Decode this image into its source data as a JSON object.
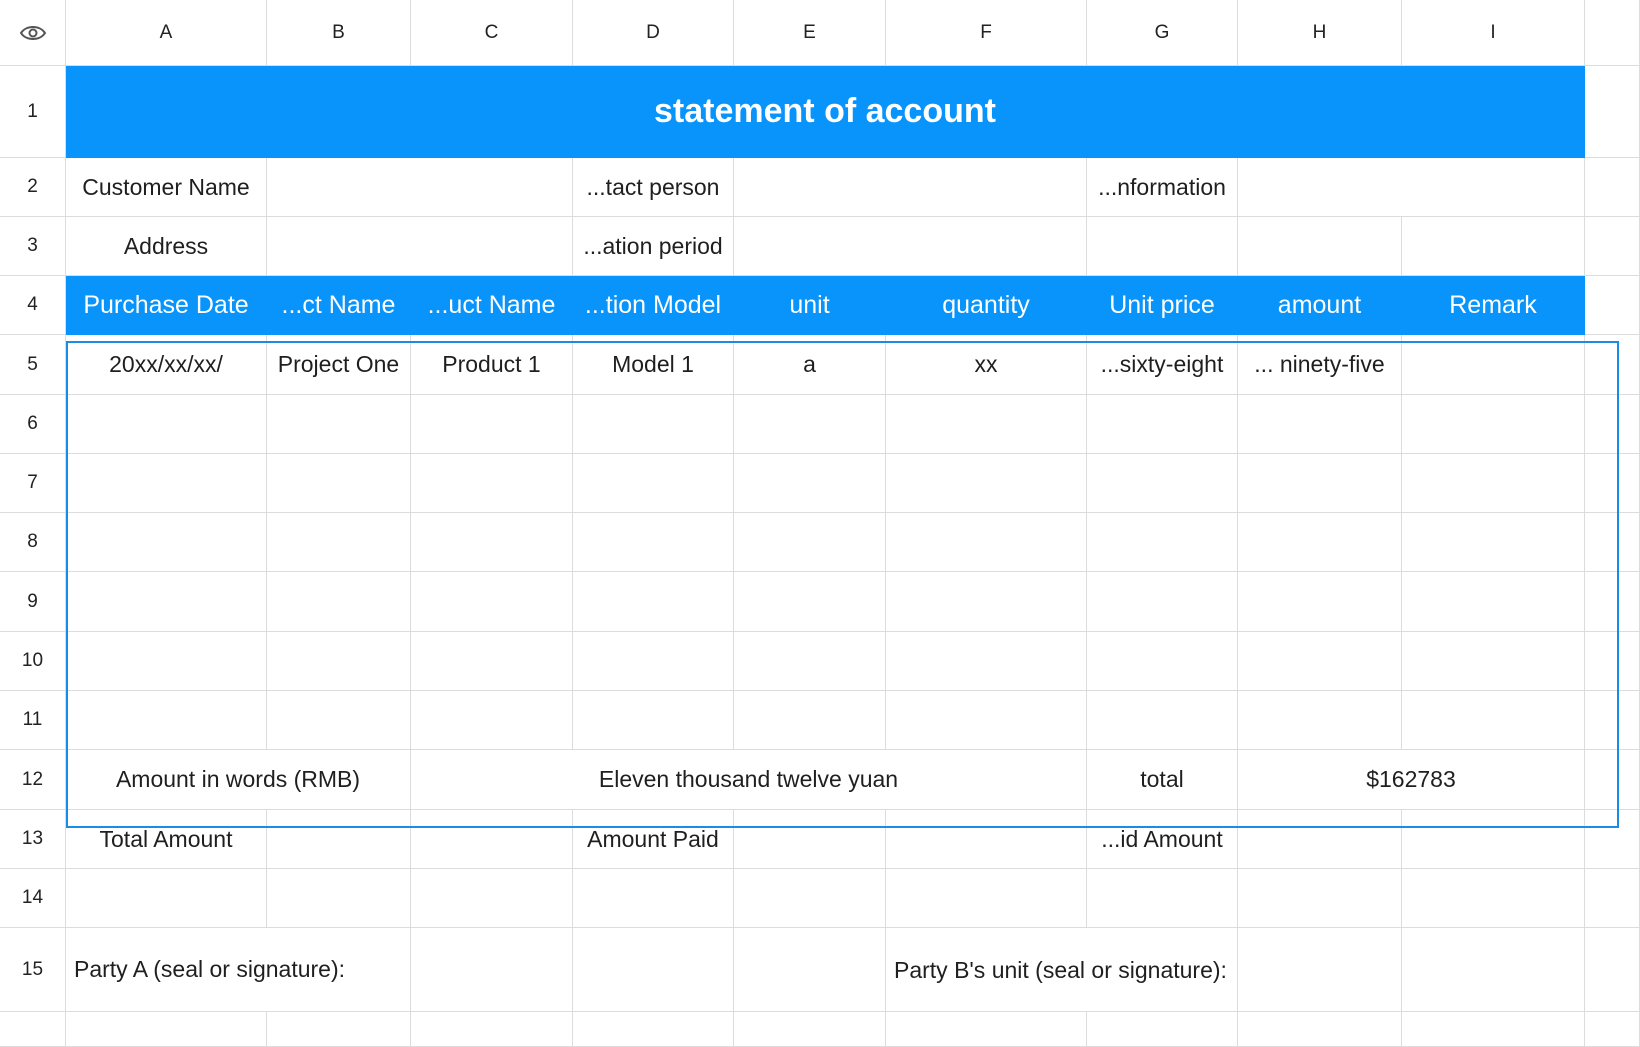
{
  "sheet": {
    "columns": [
      "A",
      "B",
      "C",
      "D",
      "E",
      "F",
      "G",
      "H",
      "I"
    ],
    "rows": [
      "1",
      "2",
      "3",
      "4",
      "5",
      "6",
      "7",
      "8",
      "9",
      "10",
      "11",
      "12",
      "13",
      "14",
      "15"
    ],
    "corner_icon": "eye-icon",
    "accent_color": "#0894fa",
    "selection_color": "#1b8ce3"
  },
  "cells": {
    "title": "statement of account",
    "customer_name_label": "Customer Name",
    "contact_person_label": "...tact person",
    "information_label": "...nformation",
    "address_label": "Address",
    "reconciliation_period_label": "...ation period",
    "headers": [
      "Purchase Date",
      "...ct Name",
      "...uct Name",
      "...tion Model",
      "unit",
      "quantity",
      "Unit price",
      "amount",
      "Remark"
    ],
    "row5": [
      "20xx/xx/xx/",
      "Project One",
      "Product 1",
      "Model 1",
      "a",
      "xx",
      "...sixty-eight",
      "... ninety-five",
      ""
    ],
    "amount_in_words_label": "Amount in words (RMB)",
    "amount_in_words_value": "Eleven thousand twelve yuan",
    "total_label": "total",
    "total_value": "$162783",
    "total_amount_label": "Total Amount",
    "amount_paid_label": "Amount Paid",
    "unpaid_amount_label": "...id Amount",
    "party_a_label": "Party A (seal or signature):",
    "party_b_label": "Party B's unit (seal or signature):"
  }
}
